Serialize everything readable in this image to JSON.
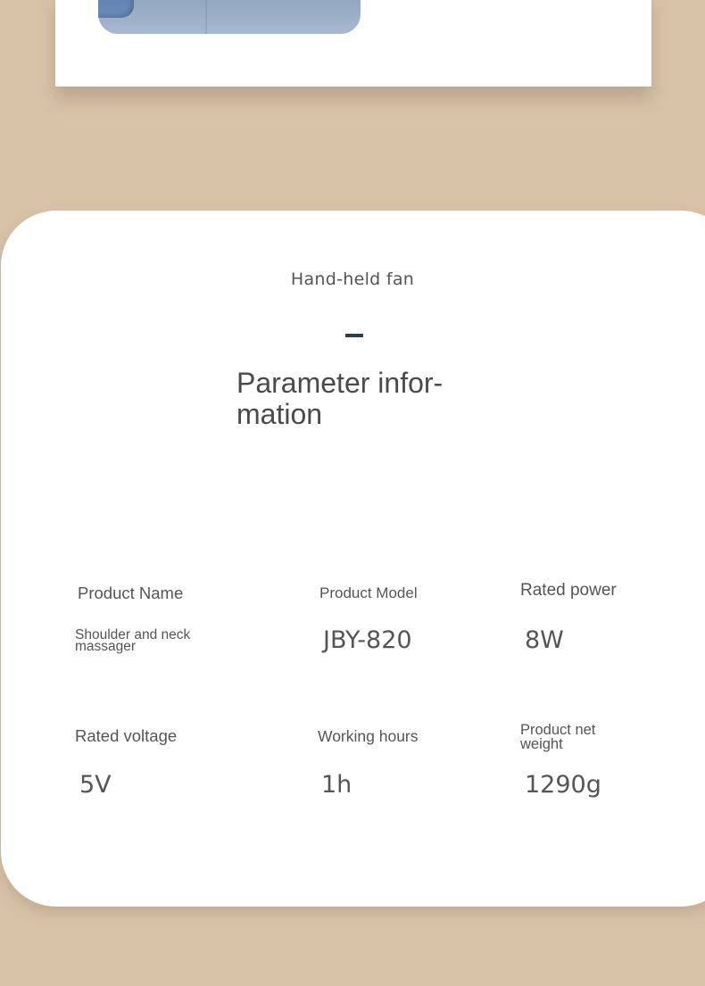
{
  "header": {
    "subtitle": "Hand-held fan",
    "title": "Parameter infor-mation",
    "title_line1": "Parameter infor-",
    "title_line2": "mation"
  },
  "parameters": [
    {
      "label": "Product Name",
      "value": "Shoulder and neck massager"
    },
    {
      "label": "Product Model",
      "value": "JBY-820"
    },
    {
      "label": "Rated power",
      "value": "8W"
    },
    {
      "label": "Rated voltage",
      "value": "5V"
    },
    {
      "label": "Working hours",
      "value": "1h"
    },
    {
      "label": "Product net weight",
      "value": "1290g"
    }
  ],
  "colors": {
    "background": "#d8c3a8",
    "panel": "#ffffff",
    "text": "#555555",
    "accent_dash": "#2e3f54",
    "product_blue": "#9aaec7"
  }
}
